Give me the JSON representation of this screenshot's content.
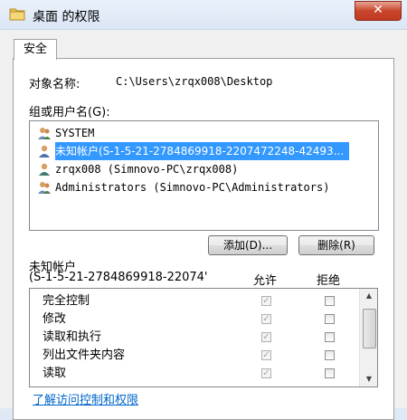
{
  "window": {
    "title": "桌面 的权限",
    "close_glyph": "✕"
  },
  "tab": {
    "label": "安全"
  },
  "object": {
    "label": "对象名称:",
    "path": "C:\\Users\\zrqx008\\Desktop"
  },
  "groups": {
    "label": "组或用户名(G):",
    "items": [
      {
        "name": "SYSTEM",
        "icon": "user-group-icon",
        "selected": false
      },
      {
        "name": "未知帐户(S-1-5-21-2784869918-2207472248-42493...",
        "icon": "unknown-user-icon",
        "selected": true
      },
      {
        "name": "zrqx008 (Simnovo-PC\\zrqx008)",
        "icon": "user-icon",
        "selected": false
      },
      {
        "name": "Administrators (Simnovo-PC\\Administrators)",
        "icon": "user-group-icon",
        "selected": false
      }
    ]
  },
  "buttons": {
    "add": "添加(D)...",
    "remove": "删除(R)"
  },
  "permissions": {
    "principal_line1": "未知帐户",
    "principal_line2": "(S-1-5-21-2784869918-22074'",
    "allow_header": "允许",
    "deny_header": "拒绝",
    "rows": [
      {
        "name": "完全控制",
        "allow": true,
        "deny": false
      },
      {
        "name": "修改",
        "allow": true,
        "deny": false
      },
      {
        "name": "读取和执行",
        "allow": true,
        "deny": false
      },
      {
        "name": "列出文件夹内容",
        "allow": true,
        "deny": false
      },
      {
        "name": "读取",
        "allow": true,
        "deny": false
      }
    ]
  },
  "link": {
    "text": "了解访问控制和权限"
  },
  "colors": {
    "selection": "#3399ff",
    "link": "#0066cc",
    "close": "#c8452b"
  }
}
